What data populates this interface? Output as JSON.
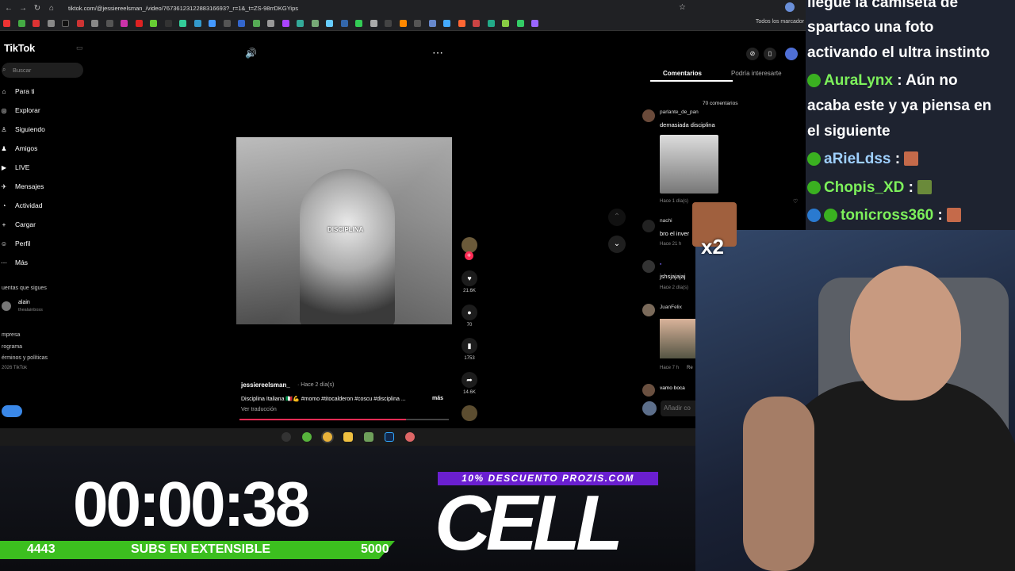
{
  "browser": {
    "url": "tiktok.com/@jessiereelsman_/video/7673612312288316693?_r=1&_t=ZS-98rrDKGYips",
    "all_bookmarks": "Todos los marcador"
  },
  "tiktok": {
    "logo": "TikTok",
    "search_placeholder": "Buscar",
    "nav": [
      {
        "label": "Para ti",
        "icon": "home-icon"
      },
      {
        "label": "Explorar",
        "icon": "compass-icon"
      },
      {
        "label": "Siguiendo",
        "icon": "following-icon"
      },
      {
        "label": "Amigos",
        "icon": "friends-icon"
      },
      {
        "label": "LIVE",
        "icon": "live-icon"
      },
      {
        "label": "Mensajes",
        "icon": "message-icon"
      },
      {
        "label": "Actividad",
        "icon": "activity-icon"
      },
      {
        "label": "Cargar",
        "icon": "upload-icon"
      },
      {
        "label": "Perfil",
        "icon": "profile-icon"
      },
      {
        "label": "Más",
        "icon": "more-icon"
      }
    ],
    "following_header": "uentas que sigues",
    "following_user": {
      "name": "alain",
      "handle": "thealainboss"
    },
    "footer": [
      "mpresa",
      "rograma",
      "érminos y políticas",
      "2026 TikTok"
    ],
    "video": {
      "overlay_text": "DISCIPLINA",
      "author": "jessiereelsman_",
      "time": "· Hace 2 día(s)",
      "caption": "Disciplina Italiana 🇮🇹💪 #momo #titocalderon #coscu #disciplina ...",
      "more": "más",
      "translate": "Ver traducción"
    },
    "actions": [
      {
        "icon": "heart-icon",
        "count": "21.6K"
      },
      {
        "icon": "comment-icon",
        "count": "70"
      },
      {
        "icon": "bookmark-icon",
        "count": "1753"
      },
      {
        "icon": "share-icon",
        "count": "14.6K"
      }
    ],
    "tabs": {
      "comments": "Comentarios",
      "related": "Podría interesarte"
    },
    "comment_count": "70 comentarios",
    "comments": [
      {
        "author": "parlante_de_pan",
        "text": "demasiada disciplina",
        "meta": "Hace 1 día(s)"
      },
      {
        "author": "nachi",
        "text": "bro el inver",
        "meta": "Hace 21 h"
      },
      {
        "author": "",
        "text": "jshsjajajaj",
        "meta": "Hace 2 día(s)"
      },
      {
        "author": "JuanFelix",
        "text": "",
        "meta": "Hace 7 h"
      },
      {
        "author": "",
        "text": "vamo boca",
        "meta": ""
      }
    ],
    "add_comment": "Añadir co",
    "reply": "Re"
  },
  "stream": {
    "timer": "00:00:38",
    "subs_current": "4443",
    "subs_label": "SUBS EN EXTENSIBLE",
    "subs_goal": "5000",
    "subs_progress": 0.8886,
    "promo": "10% DESCUENTO PROZIS.COM",
    "brand": "CELL",
    "multiplier": "x2"
  },
  "chat": {
    "lines": [
      {
        "name": "",
        "text": "llegue la camiseta de"
      },
      {
        "name": "",
        "text": "spartaco una foto"
      },
      {
        "name": "",
        "text": "activando el ultra instinto"
      },
      {
        "name": "AuraLynx",
        "text": ": Aún no"
      },
      {
        "name": "",
        "text": "acaba este y ya piensa en"
      },
      {
        "name": "",
        "text": "el siguiente"
      },
      {
        "name": "aRieLdss",
        "text": ":"
      },
      {
        "name": "Chopis_XD",
        "text": ":"
      },
      {
        "name": "tonicross360",
        "text": ":"
      }
    ]
  }
}
